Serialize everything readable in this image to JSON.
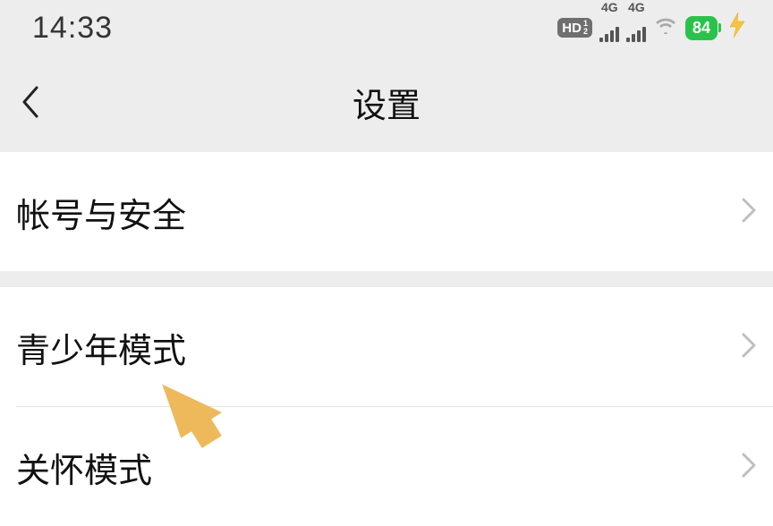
{
  "status": {
    "time": "14:33",
    "hd": "HD",
    "hd_sub1": "1",
    "hd_sub2": "2",
    "net1": "4G",
    "net2": "4G",
    "battery": "84"
  },
  "header": {
    "title": "设置"
  },
  "groups": [
    {
      "rows": [
        {
          "label": "帐号与安全"
        }
      ]
    },
    {
      "rows": [
        {
          "label": "青少年模式"
        },
        {
          "label": "关怀模式"
        }
      ]
    }
  ]
}
